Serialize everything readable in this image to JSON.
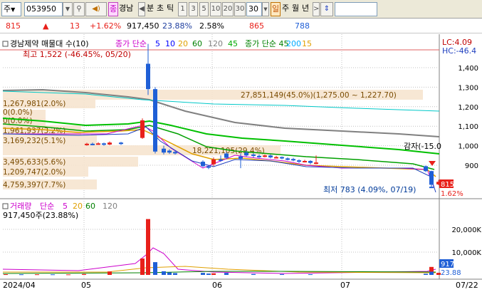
{
  "toolbar": {
    "market": "주",
    "code": "053950",
    "tab_jongga": "종",
    "tab_name": "경남",
    "tab_bun": "분",
    "tab_cho": "초",
    "tab_tick": "틱",
    "periods": [
      "1",
      "3",
      "5",
      "10",
      "20",
      "30"
    ],
    "period_selected": "30",
    "tab_il": "일",
    "tab_ju": "주",
    "tab_wol": "월",
    "tab_nyeon": "년"
  },
  "quote": {
    "price": "815",
    "arrow": "▲",
    "change": "13",
    "change_pct": "+1.62%",
    "volume": "917,450",
    "turnover": "23.88%",
    "pct2": "2.58%",
    "prev": "865",
    "value": "788"
  },
  "chart_data": [
    {
      "type": "candlestick",
      "title": "경남제약 매물대 수(10)",
      "legend": [
        {
          "label": "종가 단순",
          "color": "#cc00cc"
        },
        {
          "label": "5",
          "color": "#0000ff"
        },
        {
          "label": "10",
          "color": "#0000ff"
        },
        {
          "label": "20",
          "color": "#e0a000"
        },
        {
          "label": "60",
          "color": "#008000"
        },
        {
          "label": "120",
          "color": "#808080"
        },
        {
          "label": "45",
          "color": "#00aa00"
        },
        {
          "label": "종가 단순 45",
          "color": "#008000"
        },
        {
          "label": "200",
          "color": "#00aaff"
        },
        {
          "label": "15",
          "color": "#e0a000"
        }
      ],
      "y_ticks": [
        "1,400",
        "1,300",
        "1,200",
        "1,100",
        "1,000",
        "900"
      ],
      "ylim": [
        750,
        1500
      ],
      "x_ticks": [
        "2024/04",
        "05",
        "06",
        "07",
        "07/22"
      ],
      "lc_label": "LC:4.09",
      "hc_label": "HC:-46.4",
      "high_annotation": "최고 1,522 (-46.45%, 05/20)",
      "low_annotation": "최저 783 (4.09%, 07/19)",
      "signal_annotation": "감자(-15.0",
      "price_tag": "815",
      "pct_tag": "1.62%",
      "volume_profile": [
        {
          "label": "27,851,149(45.0%)(1,275.00 ~ 1,227.70)"
        },
        {
          "label": "1,267,981(2.0%)"
        },
        {
          "label": "0(0.0%)"
        },
        {
          "label": "0(0.0%)"
        },
        {
          "label": "1,961,937(3.2%)"
        },
        {
          "label": "3,169,232(5.1%)"
        },
        {
          "label": "18,221,105(29.4%)"
        },
        {
          "label": "3,495,633(5.6%)"
        },
        {
          "label": "1,209,747(2.0%)"
        },
        {
          "label": "4,759,397(7.7%)"
        }
      ],
      "candles": [
        {
          "d": "05/08",
          "o": 1005,
          "c": 1010,
          "h": 1015,
          "l": 1000
        },
        {
          "d": "05/09",
          "o": 1010,
          "c": 1008,
          "h": 1016,
          "l": 1002
        },
        {
          "d": "05/10",
          "o": 1008,
          "c": 1012,
          "h": 1018,
          "l": 1004
        },
        {
          "d": "05/13",
          "o": 1012,
          "c": 1006,
          "h": 1016,
          "l": 1000
        },
        {
          "d": "05/14",
          "o": 1006,
          "c": 1016,
          "h": 1022,
          "l": 1003
        },
        {
          "d": "05/16",
          "o": 1016,
          "c": 1010,
          "h": 1020,
          "l": 1004
        },
        {
          "d": "05/17",
          "o": 1040,
          "c": 1130,
          "h": 1140,
          "l": 1035
        },
        {
          "d": "05/20",
          "o": 1420,
          "c": 1290,
          "h": 1522,
          "l": 1260
        },
        {
          "d": "05/21",
          "o": 1290,
          "c": 970,
          "h": 1300,
          "l": 960
        },
        {
          "d": "05/22",
          "o": 985,
          "c": 965,
          "h": 1000,
          "l": 955
        },
        {
          "d": "05/23",
          "o": 975,
          "c": 965,
          "h": 982,
          "l": 958
        },
        {
          "d": "05/24",
          "o": 968,
          "c": 962,
          "h": 975,
          "l": 955
        },
        {
          "d": "06/04",
          "o": 918,
          "c": 895,
          "h": 925,
          "l": 890
        },
        {
          "d": "06/05",
          "o": 895,
          "c": 887,
          "h": 900,
          "l": 880
        },
        {
          "d": "06/07",
          "o": 905,
          "c": 930,
          "h": 940,
          "l": 895
        },
        {
          "d": "06/10",
          "o": 930,
          "c": 925,
          "h": 950,
          "l": 918
        },
        {
          "d": "06/11",
          "o": 960,
          "c": 938,
          "h": 968,
          "l": 932
        },
        {
          "d": "06/13",
          "o": 945,
          "c": 932,
          "h": 960,
          "l": 885
        },
        {
          "d": "06/14",
          "o": 965,
          "c": 950,
          "h": 975,
          "l": 945
        },
        {
          "d": "06/17",
          "o": 955,
          "c": 948,
          "h": 962,
          "l": 940
        },
        {
          "d": "06/18",
          "o": 948,
          "c": 945,
          "h": 955,
          "l": 938
        },
        {
          "d": "06/19",
          "o": 945,
          "c": 950,
          "h": 955,
          "l": 940
        },
        {
          "d": "06/20",
          "o": 950,
          "c": 940,
          "h": 955,
          "l": 935
        },
        {
          "d": "06/21",
          "o": 940,
          "c": 942,
          "h": 948,
          "l": 935
        },
        {
          "d": "06/24",
          "o": 942,
          "c": 935,
          "h": 945,
          "l": 930
        },
        {
          "d": "06/25",
          "o": 935,
          "c": 930,
          "h": 940,
          "l": 925
        },
        {
          "d": "06/26",
          "o": 932,
          "c": 925,
          "h": 938,
          "l": 920
        },
        {
          "d": "06/27",
          "o": 925,
          "c": 918,
          "h": 930,
          "l": 912
        },
        {
          "d": "06/28",
          "o": 918,
          "c": 922,
          "h": 928,
          "l": 914
        },
        {
          "d": "07/01",
          "o": 922,
          "c": 912,
          "h": 926,
          "l": 905
        },
        {
          "d": "07/02",
          "o": 912,
          "c": 914,
          "h": 950,
          "l": 905
        },
        {
          "d": "07/17",
          "o": 895,
          "c": 870,
          "h": 898,
          "l": 865
        },
        {
          "d": "07/18",
          "o": 870,
          "c": 800,
          "h": 872,
          "l": 795
        },
        {
          "d": "07/19",
          "o": 790,
          "c": 784,
          "h": 800,
          "l": 783
        },
        {
          "d": "07/22",
          "o": 802,
          "c": 815,
          "h": 825,
          "l": 798
        }
      ]
    },
    {
      "type": "bar",
      "title": "거래량",
      "legend": [
        {
          "label": "거래량",
          "color": "#cc00cc"
        },
        {
          "label": "단순",
          "color": "#cc00cc"
        },
        {
          "label": "5",
          "color": "#cc00cc"
        },
        {
          "label": "20",
          "color": "#e0a000"
        },
        {
          "label": "60",
          "color": "#008000"
        },
        {
          "label": "120",
          "color": "#808080"
        }
      ],
      "current": "917,450주(23.88%)",
      "y_ticks": [
        "20,000K",
        "10,000K"
      ],
      "ylim": [
        0,
        26000
      ],
      "unit": "K",
      "bars": [
        {
          "d": "04/01",
          "v": 300,
          "up": true
        },
        {
          "d": "04/08",
          "v": 250,
          "up": false
        },
        {
          "d": "04/15",
          "v": 260,
          "up": true
        },
        {
          "d": "04/22",
          "v": 240,
          "up": false
        },
        {
          "d": "04/29",
          "v": 220,
          "up": true
        },
        {
          "d": "05/07",
          "v": 400,
          "up": true
        },
        {
          "d": "05/14",
          "v": 1500,
          "up": true
        },
        {
          "d": "05/17",
          "v": 7200,
          "up": true
        },
        {
          "d": "05/20",
          "v": 24500,
          "up": true
        },
        {
          "d": "05/21",
          "v": 5600,
          "up": false
        },
        {
          "d": "05/22",
          "v": 1600,
          "up": false
        },
        {
          "d": "05/23",
          "v": 1100,
          "up": false
        },
        {
          "d": "05/24",
          "v": 800,
          "up": false
        },
        {
          "d": "06/04",
          "v": 900,
          "up": false
        },
        {
          "d": "06/05",
          "v": 600,
          "up": false
        },
        {
          "d": "06/07",
          "v": 700,
          "up": true
        },
        {
          "d": "06/11",
          "v": 900,
          "up": false
        },
        {
          "d": "06/17",
          "v": 400,
          "up": false
        },
        {
          "d": "06/24",
          "v": 350,
          "up": false
        },
        {
          "d": "07/01",
          "v": 300,
          "up": false
        },
        {
          "d": "07/17",
          "v": 500,
          "up": false
        },
        {
          "d": "07/18",
          "v": 3500,
          "up": true
        },
        {
          "d": "07/19",
          "v": 1400,
          "up": false
        },
        {
          "d": "07/22",
          "v": 917,
          "up": true
        }
      ],
      "x_ticks": [
        "2024/04",
        "05",
        "06",
        "07",
        "07/22"
      ]
    }
  ],
  "colors": {
    "up": "#e8201a",
    "down": "#1f5fd6",
    "profile_fill": "#f6e4cf",
    "profile_text": "#7a4b00",
    "high_text": "#c00000",
    "low_text": "#003a99",
    "grid": "#c0c0c0"
  }
}
